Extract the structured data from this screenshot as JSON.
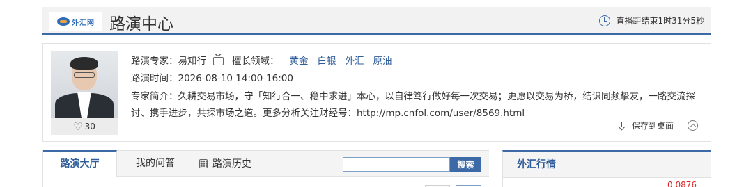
{
  "header": {
    "logo_text": "外汇网",
    "title": "路演中心",
    "countdown": "直播距结束1时31分5秒"
  },
  "expert": {
    "likes": "30",
    "expert_label": "路演专家：",
    "expert_name": "易知行",
    "skills_label": "擅长领域：",
    "skills": [
      "黄金",
      "白银",
      "外汇",
      "原油"
    ],
    "time_label": "路演时间：",
    "time_value": "2026-08-10 14:00-16:00",
    "intro_label": "专家简介：",
    "intro_text": "久耕交易市场，守「知行合一、稳中求进」本心，以自律笃行做好每一次交易；更愿以交易为桥，结识同频挚友，一路交流探讨、携手进步，共探市场之道。更多分析关注财经号：http://mp.cnfol.com/user/8569.html",
    "save_label": "保存到桌面"
  },
  "tabs": [
    {
      "label": "路演大厅",
      "active": true
    },
    {
      "label": "我的问答",
      "active": false
    },
    {
      "label": "路演历史",
      "active": false
    }
  ],
  "search": {
    "value": "",
    "placeholder": "",
    "button_label": "搜索"
  },
  "forex": {
    "title": "外汇行情",
    "partial_value": "0.0876"
  },
  "colors": {
    "accent": "#3d6aa6",
    "link": "#2f5d9a",
    "price_red": "#e02020"
  }
}
